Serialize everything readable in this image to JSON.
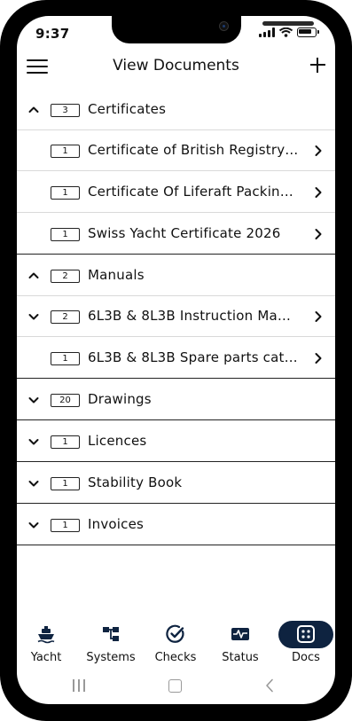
{
  "status_bar": {
    "time": "9:37"
  },
  "header": {
    "title": "View Documents"
  },
  "sections": [
    {
      "count": "3",
      "label": "Certificates",
      "expanded": true,
      "items": [
        {
          "count": "1",
          "label": "Certificate of British Registry ..."
        },
        {
          "count": "1",
          "label": "Certificate Of Liferaft Packing..."
        },
        {
          "count": "1",
          "label": "Swiss Yacht Certificate 2026"
        }
      ]
    },
    {
      "count": "2",
      "label": "Manuals",
      "expanded": true,
      "items": [
        {
          "count": "2",
          "label": "6L3B & 8L3B Instruction Manu...",
          "collapsible": true
        },
        {
          "count": "1",
          "label": "6L3B & 8L3B Spare parts cata..."
        }
      ]
    },
    {
      "count": "20",
      "label": "Drawings",
      "expanded": false
    },
    {
      "count": "1",
      "label": "Licences",
      "expanded": false
    },
    {
      "count": "1",
      "label": "Stability Book",
      "expanded": false
    },
    {
      "count": "1",
      "label": "Invoices",
      "expanded": false
    }
  ],
  "bottom_nav": [
    {
      "label": "Yacht",
      "icon": "ship-icon"
    },
    {
      "label": "Systems",
      "icon": "systems-icon"
    },
    {
      "label": "Checks",
      "icon": "check-circle-icon"
    },
    {
      "label": "Status",
      "icon": "pulse-icon"
    },
    {
      "label": "Docs",
      "icon": "docs-grid-icon",
      "active": true
    }
  ],
  "colors": {
    "accent": "#0e2340",
    "text": "#111111",
    "divider": "#d9d9d9"
  }
}
